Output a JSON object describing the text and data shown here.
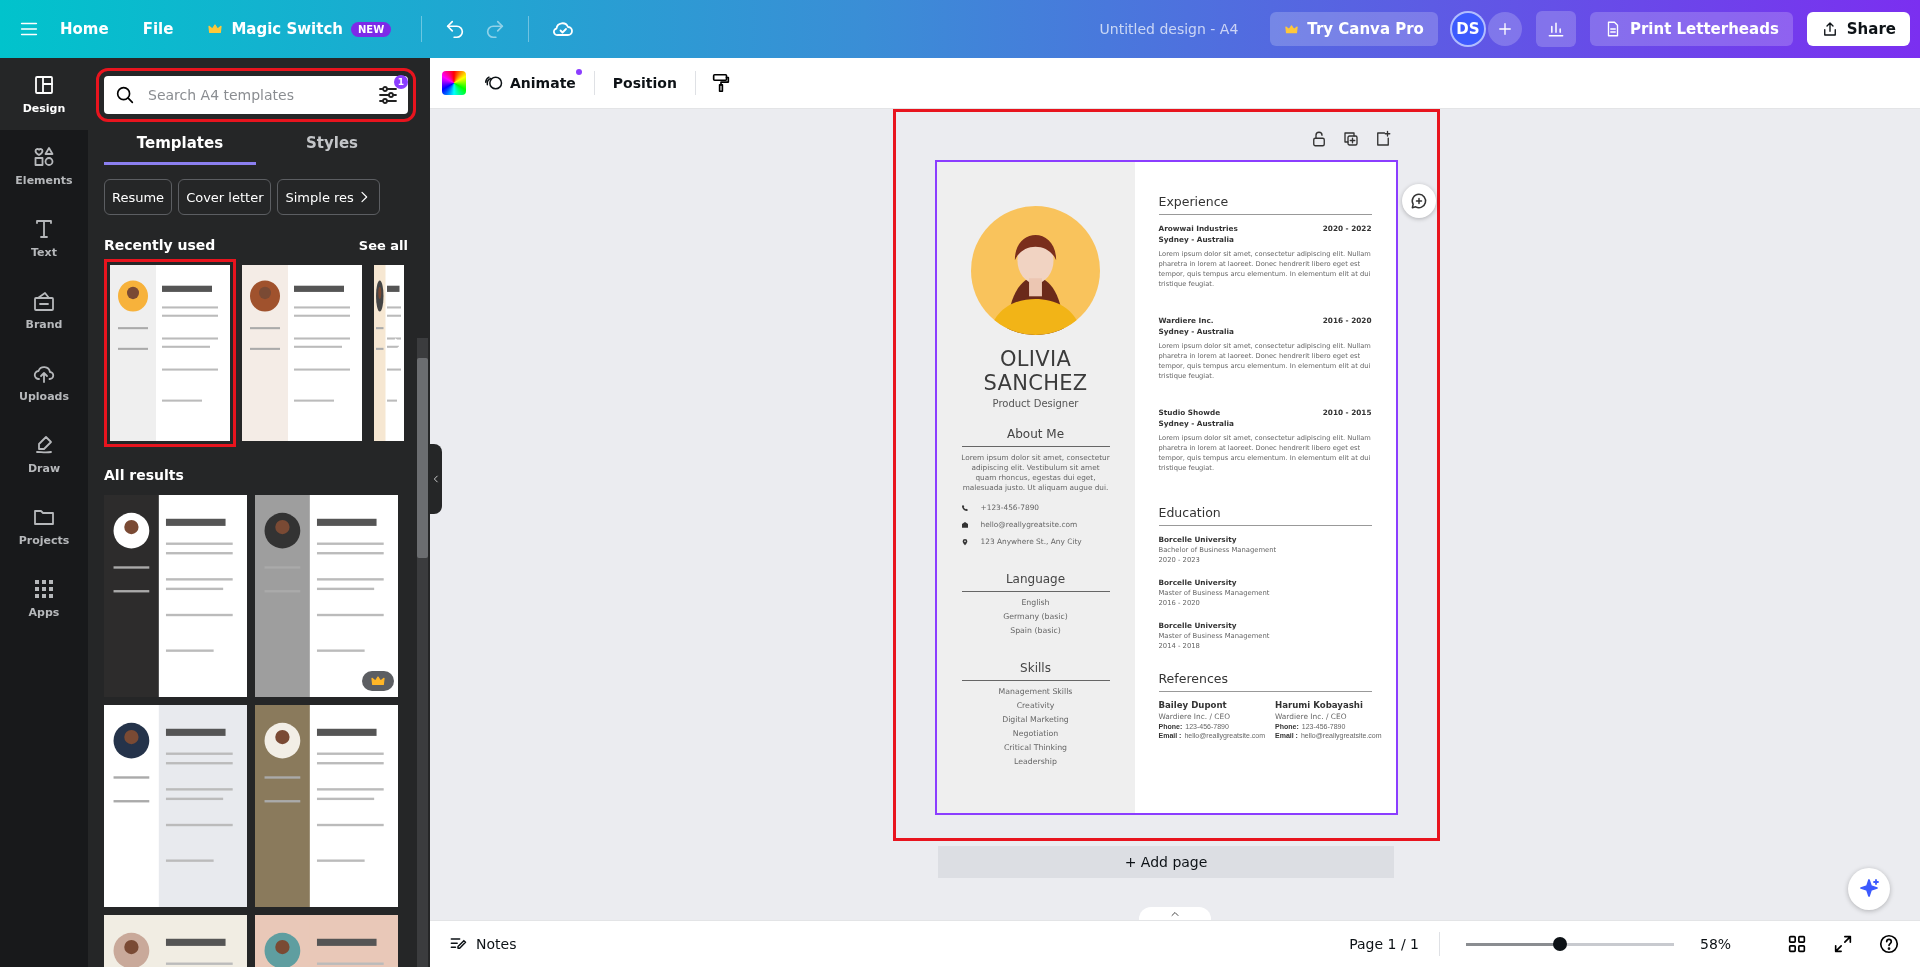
{
  "topbar": {
    "nav": [
      {
        "kind": "link",
        "label": "Home"
      },
      {
        "kind": "link",
        "label": "File"
      },
      {
        "kind": "magic",
        "label": "Magic Switch",
        "badge": "NEW"
      }
    ],
    "title": "Untitled design - A4",
    "pro_button": "Try Canva Pro",
    "avatar": "DS",
    "print_button": "Print Letterheads",
    "share_button": "Share"
  },
  "rail": [
    {
      "kind": "design",
      "label": "Design",
      "selected": true
    },
    {
      "kind": "elements",
      "label": "Elements",
      "selected": false
    },
    {
      "kind": "text",
      "label": "Text",
      "selected": false
    },
    {
      "kind": "brand",
      "label": "Brand",
      "selected": false
    },
    {
      "kind": "uploads",
      "label": "Uploads",
      "selected": false
    },
    {
      "kind": "draw",
      "label": "Draw",
      "selected": false
    },
    {
      "kind": "projects",
      "label": "Projects",
      "selected": false
    },
    {
      "kind": "apps",
      "label": "Apps",
      "selected": false
    }
  ],
  "panel": {
    "search": {
      "placeholder": "Search A4 templates",
      "filter_count": "1"
    },
    "tabs": [
      {
        "label": "Templates",
        "selected": true
      },
      {
        "label": "Styles",
        "selected": false
      }
    ],
    "chips": [
      "Resume",
      "Cover letter",
      "Simple res"
    ],
    "recent": {
      "heading": "Recently used",
      "see_all": "See all",
      "thumbs": [
        {
          "kind": "picture",
          "highlighted": true
        },
        {
          "kind": "picture",
          "highlighted": false
        },
        {
          "kind": "picture",
          "highlighted": false
        }
      ]
    },
    "results_heading": "All results",
    "results": [
      {
        "kind": "picture",
        "premium": false
      },
      {
        "kind": "picture",
        "premium": true
      },
      {
        "kind": "picture",
        "premium": false
      },
      {
        "kind": "picture",
        "premium": false
      },
      {
        "kind": "picture",
        "premium": false
      },
      {
        "kind": "picture",
        "premium": false
      }
    ]
  },
  "toolbar": {
    "animate": "Animate",
    "position": "Position"
  },
  "resume": {
    "name": "OLIVIA SANCHEZ",
    "title": "Product Designer",
    "about": {
      "heading": "About Me",
      "text": "Lorem ipsum dolor sit amet, consectetur adipiscing elit. Vestibulum sit amet quam rhoncus, egestas dui eget, malesuada justo. Ut aliquam augue dui."
    },
    "contacts": [
      {
        "kind": "phone",
        "text": "+123-456-7890"
      },
      {
        "kind": "email",
        "text": "hello@reallygreatsite.com"
      },
      {
        "kind": "address",
        "text": "123 Anywhere St., Any City"
      }
    ],
    "language": {
      "heading": "Language",
      "items": [
        "English",
        "Germany (basic)",
        "Spain (basic)"
      ]
    },
    "skills": {
      "heading": "Skills",
      "items": [
        "Management Skills",
        "Creativity",
        "Digital Marketing",
        "Negotiation",
        "Critical Thinking",
        "Leadership"
      ]
    },
    "experience": {
      "heading": "Experience",
      "jobs": [
        {
          "company": "Arowwai Industries",
          "years": "2020 - 2022",
          "place": "Sydney - Australia",
          "text": "Lorem ipsum dolor sit amet, consectetur adipiscing elit. Nullam pharetra in lorem at laoreet. Donec hendrerit libero eget est tempor, quis tempus arcu elementum. In elementum elit at dui tristique feugiat."
        },
        {
          "company": "Wardiere Inc.",
          "years": "2016 - 2020",
          "place": "Sydney - Australia",
          "text": "Lorem ipsum dolor sit amet, consectetur adipiscing elit. Nullam pharetra in lorem at laoreet. Donec hendrerit libero eget est tempor, quis tempus arcu elementum. In elementum elit at dui tristique feugiat."
        },
        {
          "company": "Studio Showde",
          "years": "2010 - 2015",
          "place": "Sydney - Australia",
          "text": "Lorem ipsum dolor sit amet, consectetur adipiscing elit. Nullam pharetra in lorem at laoreet. Donec hendrerit libero eget est tempor, quis tempus arcu elementum. In elementum elit at dui tristique feugiat."
        }
      ]
    },
    "education": {
      "heading": "Education",
      "items": [
        {
          "school": "Borcelle University",
          "degree": "Bachelor of Business Management",
          "years": "2020 - 2023"
        },
        {
          "school": "Borcelle University",
          "degree": "Master of Business Management",
          "years": "2016 - 2020"
        },
        {
          "school": "Borcelle University",
          "degree": "Master of Business Management",
          "years": "2014 - 2018"
        }
      ]
    },
    "references": {
      "heading": "References",
      "people": [
        {
          "name": "Bailey Dupont",
          "role": "Wardiere Inc. / CEO",
          "phone_label": "Phone:",
          "phone": "123-456-7890",
          "email_label": "Email :",
          "email": "hello@reallygreatsite.com"
        },
        {
          "name": "Harumi Kobayashi",
          "role": "Wardiere Inc. / CEO",
          "phone_label": "Phone:",
          "phone": "123-456-7890",
          "email_label": "Email :",
          "email": "hello@reallygreatsite.com"
        }
      ]
    }
  },
  "add_page": "+ Add page",
  "footer": {
    "notes": "Notes",
    "page": "Page 1 / 1",
    "zoom": {
      "level": 0.45
    },
    "zoom_text": "58%"
  }
}
